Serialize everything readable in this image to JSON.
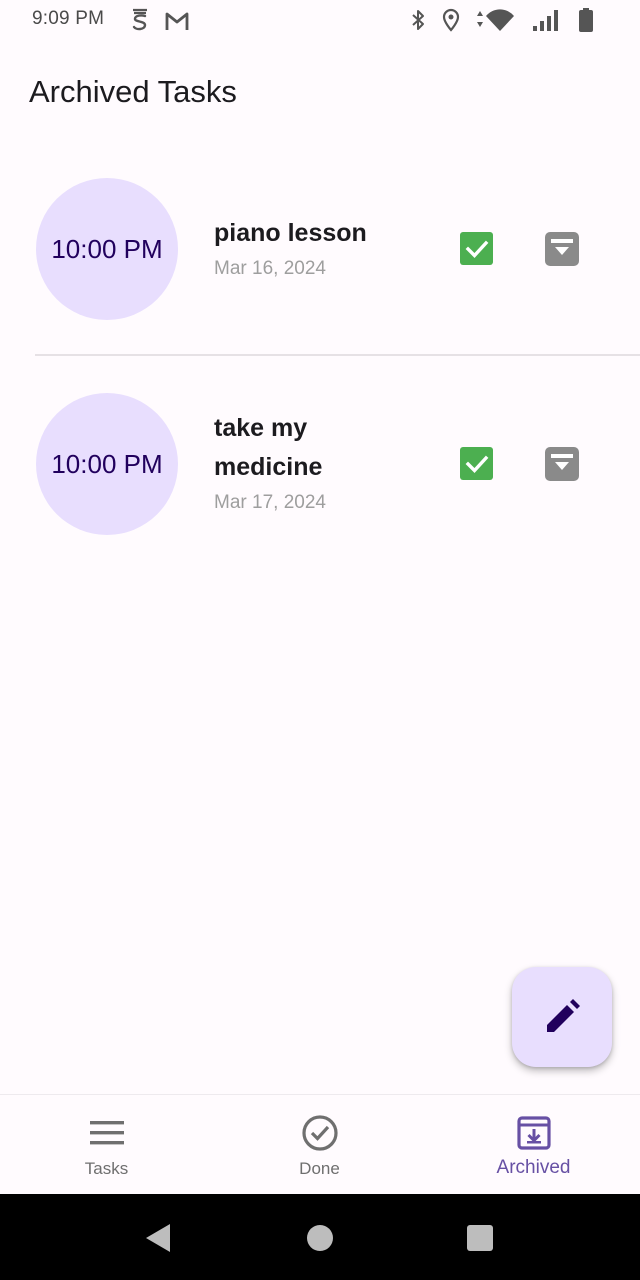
{
  "status_bar": {
    "time": "9:09 PM",
    "left_icons": [
      "sim-s-icon",
      "gmail-icon"
    ],
    "right_icons": [
      "bluetooth-icon",
      "location-icon",
      "wifi-icon",
      "signal-icon",
      "battery-icon"
    ]
  },
  "header": {
    "title": "Archived Tasks"
  },
  "tasks": [
    {
      "time": "10:00 PM",
      "title": "piano lesson",
      "date": "Mar 16, 2024",
      "done": true
    },
    {
      "time": "10:00 PM",
      "title": "take my medicine",
      "date": "Mar 17, 2024",
      "done": true
    }
  ],
  "fab": {
    "icon": "edit-pencil-icon"
  },
  "bottom_nav": {
    "items": [
      {
        "label": "Tasks",
        "icon": "menu-icon",
        "active": false
      },
      {
        "label": "Done",
        "icon": "check-circle-icon",
        "active": false
      },
      {
        "label": "Archived",
        "icon": "archive-icon",
        "active": true
      }
    ]
  },
  "colors": {
    "background": "#fffbfe",
    "time_circle": "#e8defe",
    "time_text": "#21005d",
    "check_green": "#4caf50",
    "archive_gray": "#8a8a8a",
    "active_nav": "#6750a4",
    "inactive_nav": "#6f6f6f"
  }
}
